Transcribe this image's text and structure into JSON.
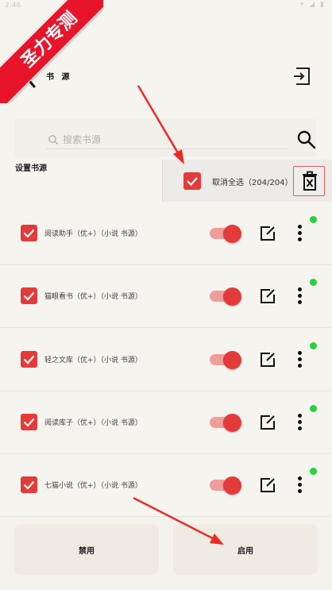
{
  "status_bar": {
    "time": "2:46",
    "icons": "▾ ◢ ▮"
  },
  "watermark": {
    "text": "圣力专测"
  },
  "header": {
    "title": "书 源"
  },
  "search": {
    "placeholder": "搜索书源"
  },
  "section_label": "设置书源",
  "selection_popup": {
    "label": "取消全选（204/204）"
  },
  "sources": [
    {
      "label": "阅读助手（优+）（小说 书源）",
      "checked": true,
      "enabled": true
    },
    {
      "label": "猫眼看书（优+）（小说 书源）",
      "checked": true,
      "enabled": true
    },
    {
      "label": "轻之文库（优+）（小说 书源）",
      "checked": true,
      "enabled": true
    },
    {
      "label": "阅读库子（优+）（小说 书源）",
      "checked": true,
      "enabled": true
    },
    {
      "label": "七猫小说（优+）（小说 书源）",
      "checked": true,
      "enabled": true
    }
  ],
  "bottom": {
    "disable_label": "禁用",
    "enable_label": "启用"
  },
  "colors": {
    "accent": "#e33b3a",
    "status_ok": "#22d33a",
    "background": "#f6f4ef"
  }
}
